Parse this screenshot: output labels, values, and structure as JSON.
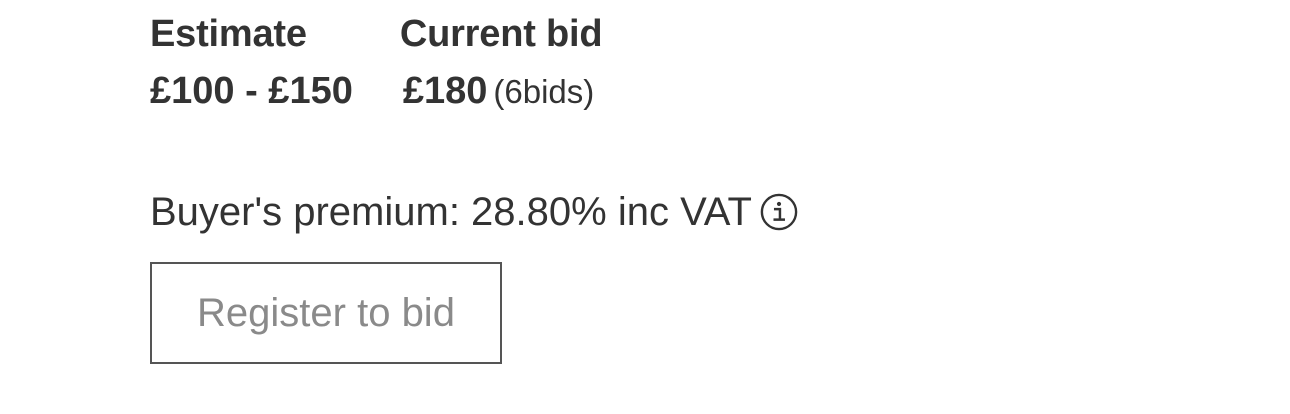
{
  "estimate": {
    "label": "Estimate",
    "value": "£100 - £150"
  },
  "current_bid": {
    "label": "Current bid",
    "amount": "£180",
    "bids": "(6bids)"
  },
  "premium": {
    "text": "Buyer's premium: 28.80% inc VAT",
    "icon": "info-icon"
  },
  "register": {
    "label": "Register to bid"
  },
  "colors": {
    "text": "#333333",
    "button_border": "#555555",
    "button_text": "#8a8a8a"
  }
}
